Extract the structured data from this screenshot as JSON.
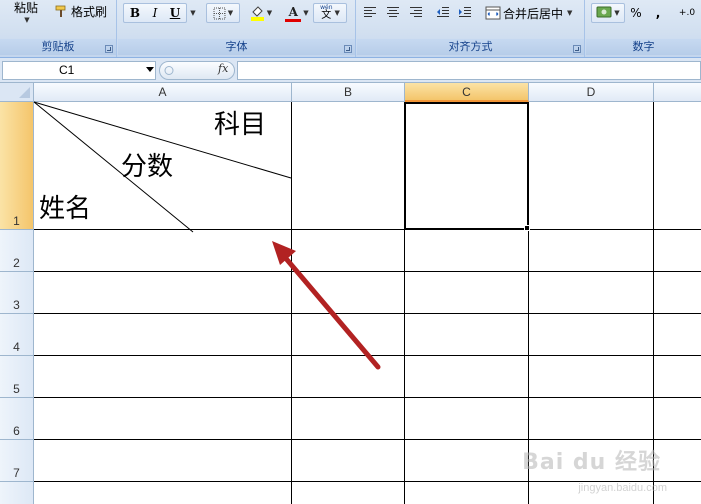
{
  "ribbon": {
    "clipboard": {
      "label": "剪贴板",
      "paste_label": "粘贴",
      "format_painter_label": "格式刷"
    },
    "font": {
      "label": "字体",
      "bold": "B",
      "italic": "I",
      "underline": "U",
      "font_color_glyph": "A",
      "phonetic_glyph_top": "wén",
      "phonetic_glyph_bottom": "文"
    },
    "alignment": {
      "label": "对齐方式",
      "merge_center_label": "合并后居中"
    },
    "number": {
      "label": "数字",
      "percent": "%",
      "comma": ",",
      "increase_decimal": "+.0"
    }
  },
  "formula_bar": {
    "name_box_value": "C1",
    "fx_label": "fx",
    "formula_value": ""
  },
  "columns": [
    "A",
    "B",
    "C",
    "D"
  ],
  "selected_column": "C",
  "rows": [
    "1",
    "2",
    "3",
    "4",
    "5",
    "6",
    "7"
  ],
  "selected_row": "1",
  "cell_a1": {
    "top_right": "科目",
    "middle": "分数",
    "bottom_left": "姓名"
  },
  "annotation": {
    "arrow_color": "#b22222"
  },
  "watermark": {
    "brand": "Bai du 经验",
    "url": "jingyan.baidu.com"
  },
  "colors": {
    "ribbon_bg": "#dbe6f4",
    "selection_header": "#f4c56b",
    "gridline": "#000000"
  }
}
